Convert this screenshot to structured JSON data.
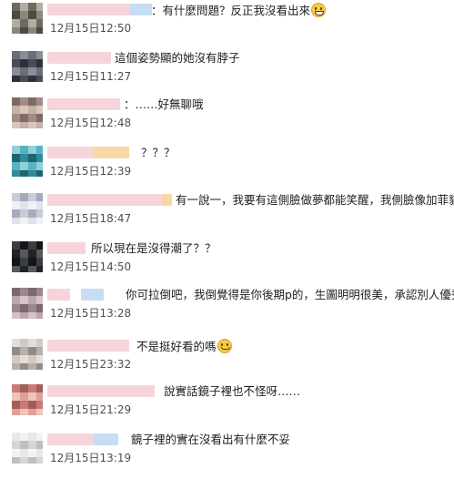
{
  "comments": [
    {
      "text": "：有什麼問題？反正我沒看出來",
      "emoji": "grinning-face-icon",
      "time": "12月15日12:50"
    },
    {
      "text": "這個姿勢顯的她沒有脖子",
      "emoji": "",
      "time": "12月15日11:27"
    },
    {
      "text": "：……好無聊哦",
      "emoji": "",
      "time": "12月15日12:48"
    },
    {
      "text": "？？？",
      "emoji": "",
      "time": "12月15日12:39"
    },
    {
      "text": "有一說一，我要有這側臉做夢都能笑醒，我側臉像加菲貓",
      "emoji": "",
      "time": "12月15日18:47"
    },
    {
      "text": "所以現在是沒得潮了？？",
      "emoji": "",
      "time": "12月15日14:50"
    },
    {
      "text": "你可拉倒吧，我倒覺得是你後期p的，生圖明明很美，承認別人優秀我",
      "emoji": "",
      "time": "12月15日13:28"
    },
    {
      "text": "不是挺好看的嗎",
      "emoji": "sweat-smile-icon",
      "time": "12月15日23:32"
    },
    {
      "text": "說實話鏡子裡也不怪呀……",
      "emoji": "",
      "time": "12月15日21:29"
    },
    {
      "text": "鏡子裡的實在沒看出有什麼不妥",
      "emoji": "",
      "time": "12月15日13:19"
    }
  ],
  "colors": {
    "text": "#1c1e21",
    "timestamp": "#4b4f56",
    "emoji": "#f7c948",
    "name_blur_pink": "#f2c9cf",
    "name_blur_blue": "#b7d4f0",
    "name_blur_orange": "#f5cd8c"
  }
}
